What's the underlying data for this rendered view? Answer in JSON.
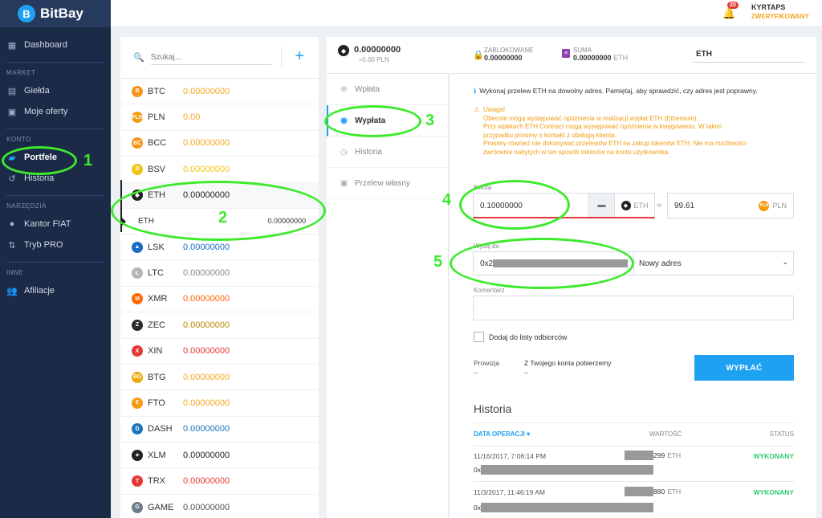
{
  "brand": {
    "name": "BitBay"
  },
  "sidebar": {
    "dashboard": "Dashboard",
    "market_label": "MARKET",
    "gielda": "Giełda",
    "moje_oferty": "Moje oferty",
    "konto_label": "KONTO",
    "portfele": "Portfele",
    "historia": "Historia",
    "narzedzia_label": "NARZĘDZIA",
    "kantor": "Kantor FIAT",
    "tryb_pro": "Tryb PRO",
    "inne_label": "INNE",
    "afiliacje": "Afiliacje"
  },
  "topbar": {
    "notifications": "20",
    "user": "KYRTAPS",
    "status": "ZWERYFIKOWANY"
  },
  "wallets": {
    "search_placeholder": "Szukaj...",
    "add": "+",
    "eth_sub_label": "ETH",
    "eth_sub_balance": "0.00000000",
    "coins": [
      {
        "sym": "BTC",
        "bal": "0.00000000",
        "color": "#f7931a",
        "balcolor": "#f5a623",
        "icon": "B"
      },
      {
        "sym": "PLN",
        "bal": "0.00",
        "color": "#f39c12",
        "balcolor": "#f5a623",
        "icon": "PLN"
      },
      {
        "sym": "BCC",
        "bal": "0.00000000",
        "color": "#f7931a",
        "balcolor": "#f5a623",
        "icon": "BC"
      },
      {
        "sym": "BSV",
        "bal": "0.00000000",
        "color": "#f1c40f",
        "balcolor": "#f1c40f",
        "icon": "B"
      },
      {
        "sym": "ETH",
        "bal": "0.00000000",
        "color": "#222222",
        "balcolor": "#222222",
        "icon": "◆"
      },
      {
        "sym": "LSK",
        "bal": "0.00000000",
        "color": "#1a6bc4",
        "balcolor": "#1a6bc4",
        "icon": "▲"
      },
      {
        "sym": "LTC",
        "bal": "0.00000000",
        "color": "#b5b5b5",
        "balcolor": "#888888",
        "icon": "Ł"
      },
      {
        "sym": "XMR",
        "bal": "0.00000000",
        "color": "#ff6600",
        "balcolor": "#ff6600",
        "icon": "M"
      },
      {
        "sym": "ZEC",
        "bal": "0.00000000",
        "color": "#2b2b2b",
        "balcolor": "#b88a00",
        "icon": "Z"
      },
      {
        "sym": "XIN",
        "bal": "0.00000000",
        "color": "#e53935",
        "balcolor": "#e53935",
        "icon": "X"
      },
      {
        "sym": "BTG",
        "bal": "0.00000000",
        "color": "#eba809",
        "balcolor": "#f5a623",
        "icon": "BG"
      },
      {
        "sym": "FTO",
        "bal": "0.00000000",
        "color": "#f39c12",
        "balcolor": "#f5a623",
        "icon": "€"
      },
      {
        "sym": "DASH",
        "bal": "0.00000000",
        "color": "#1c75bc",
        "balcolor": "#1c75bc",
        "icon": "D"
      },
      {
        "sym": "XLM",
        "bal": "0.00000000",
        "color": "#222222",
        "balcolor": "#222222",
        "icon": "✦"
      },
      {
        "sym": "TRX",
        "bal": "0.00000000",
        "color": "#e53935",
        "balcolor": "#e53935",
        "icon": "T"
      },
      {
        "sym": "GAME",
        "bal": "0.00000000",
        "color": "#6c7a89",
        "balcolor": "#555555",
        "icon": "G"
      }
    ]
  },
  "balance": {
    "amount": "0.00000000",
    "pln": "≈0.00 PLN",
    "locked_label": "ZABLOKOWANE",
    "locked_value": "0.00000000",
    "sum_label": "SUMA",
    "sum_value": "0.00000000",
    "sum_unit": "ETH",
    "currency": "ETH"
  },
  "tabs": [
    "Wpłata",
    "Wypłata",
    "Historia",
    "Przelew własny"
  ],
  "form": {
    "info": "Wykonaj przelew ETH na dowolny adres. Pamiętaj, aby sprawdzić, czy adres jest poprawny.",
    "warn_title": "Uwaga!",
    "warn_lines": [
      "Obecnie mogą występować opóźnienia w realizacji wypłat ETH (Ethereum).",
      "Przy wpłatach ETH Contract mogą występować opóźnienia w księgowaniu. W takim",
      "przypadku prosimy o kontakt z obsługą klienta.",
      "Prosimy również nie dokonywać przelewów ETH na zakup tokenów ETH. Nie ma możliwości",
      "zwrócenia nabytych w ten sposób tokenów na konto użytkownika."
    ],
    "amount_label": "Kwota",
    "amount_value": "0.10000000",
    "amount_currency": "ETH",
    "approx": "≈",
    "pln_value": "99.61",
    "pln_currency": "PLN",
    "send_to_label": "Wyślij do",
    "address_prefix": "0x2",
    "new_address": "Nowy adres",
    "comment_label": "Komentarz",
    "add_recipient": "Dodaj do listy odbiorców",
    "fee_label": "Prowizja",
    "fee_text": "Z Twojego konta pobierzemy",
    "dash": "–",
    "withdraw": "WYPŁAĆ"
  },
  "history": {
    "title": "Historia",
    "col_date": "DATA OPERACJI ▾",
    "col_value": "WARTOŚĆ",
    "col_status": "STATUS",
    "rows": [
      {
        "date": "11/16/2017, 7:06:14 PM",
        "value_suffix": "299",
        "unit": "ETH",
        "status": "WYKONANY",
        "addr": "0x"
      },
      {
        "date": "11/3/2017, 11:46:19 AM",
        "value_suffix": "880",
        "unit": "ETH",
        "status": "WYKONANY",
        "addr": "0x"
      }
    ]
  },
  "annotations": [
    "1",
    "2",
    "3",
    "4",
    "5"
  ]
}
